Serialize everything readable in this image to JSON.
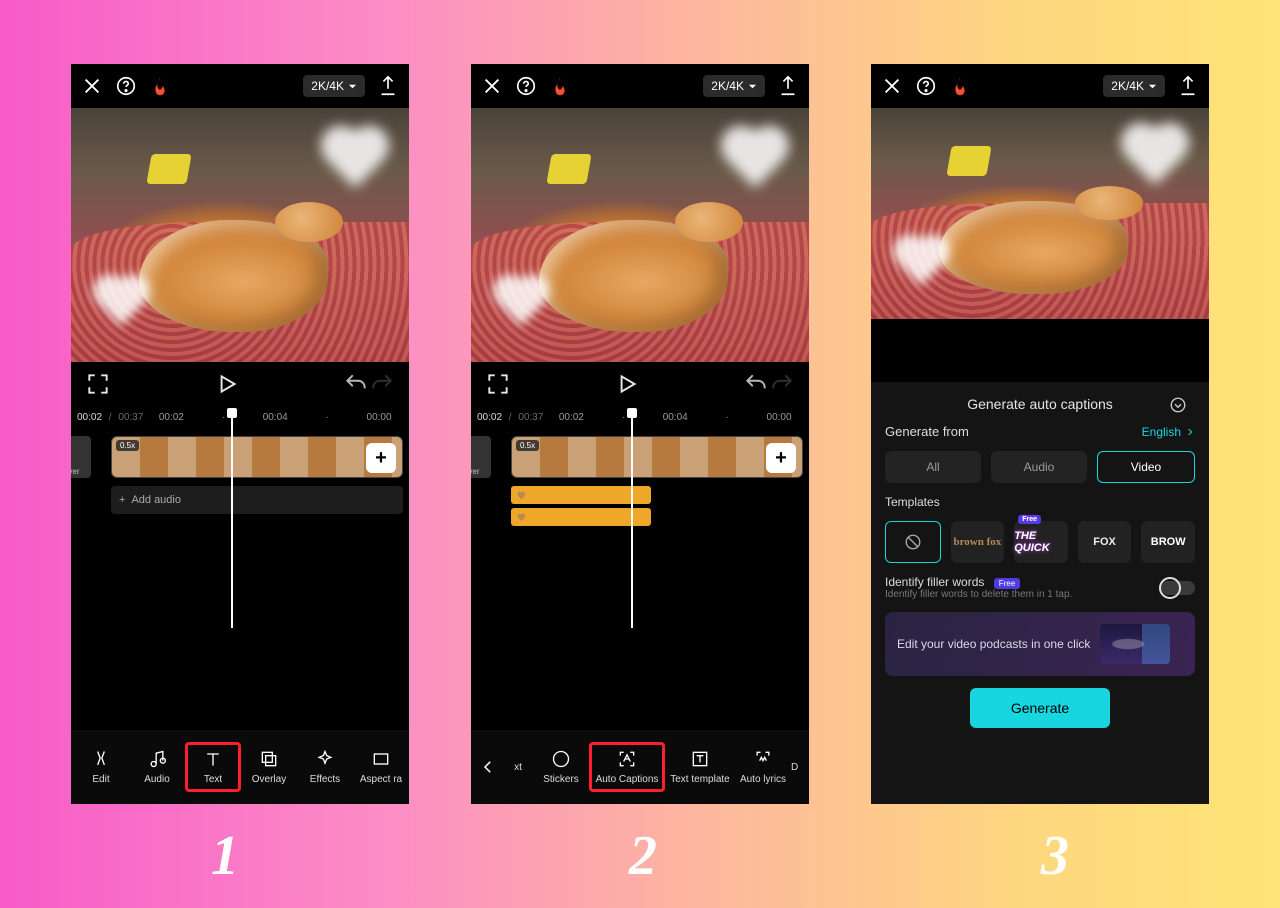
{
  "step_labels": [
    "1",
    "2",
    "3"
  ],
  "topbar": {
    "quality_label": "2K/4K"
  },
  "transport": {
    "current": "00:02",
    "total": "00:37",
    "ticks": [
      "00:02",
      "00:04",
      "00:00"
    ]
  },
  "timeline": {
    "cover": "ver",
    "speed": "0.5x",
    "add_audio": "Add audio"
  },
  "toolbar1": {
    "edit": "Edit",
    "audio": "Audio",
    "text": "Text",
    "overlay": "Overlay",
    "effects": "Effects",
    "aspect": "Aspect ra"
  },
  "toolbar2": {
    "xt": "xt",
    "stickers": "Stickers",
    "auto_captions": "Auto Captions",
    "text_template": "Text template",
    "auto_lyrics": "Auto lyrics",
    "d": "D"
  },
  "sheet": {
    "title": "Generate auto captions",
    "gen_from": "Generate from",
    "language": "English",
    "seg": {
      "all": "All",
      "audio": "Audio",
      "video": "Video"
    },
    "templates_label": "Templates",
    "tmpl": {
      "brownfox": "brown fox",
      "thequick": "THE QUICK",
      "fox": "FOX",
      "brow": "BROW"
    },
    "free": "Free",
    "filler": "Identify filler words",
    "filler_sub": "Identify filler words to delete them in 1 tap.",
    "promo": "Edit your video podcasts in one click",
    "generate": "Generate"
  }
}
